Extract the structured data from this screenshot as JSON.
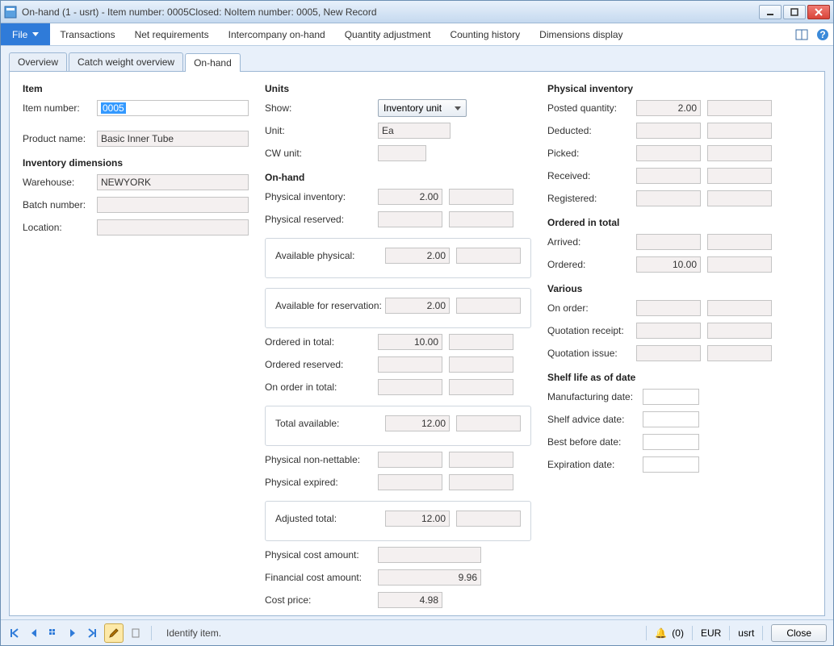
{
  "window": {
    "title": "On-hand (1 - usrt) - Item number: 0005Closed: NoItem number: 0005, New Record"
  },
  "menu": {
    "file": "File",
    "items": [
      "Transactions",
      "Net requirements",
      "Intercompany on-hand",
      "Quantity adjustment",
      "Counting history",
      "Dimensions display"
    ]
  },
  "tabs": {
    "overview": "Overview",
    "cw": "Catch weight overview",
    "onhand": "On-hand"
  },
  "item": {
    "header": "Item",
    "item_number_label": "Item number:",
    "item_number": "0005",
    "product_name_label": "Product name:",
    "product_name": "Basic Inner Tube",
    "inv_dim_header": "Inventory dimensions",
    "warehouse_label": "Warehouse:",
    "warehouse": "NEWYORK",
    "batch_label": "Batch number:",
    "batch": "",
    "location_label": "Location:",
    "location": ""
  },
  "units": {
    "header": "Units",
    "show_label": "Show:",
    "show_value": "Inventory unit",
    "unit_label": "Unit:",
    "unit": "Ea",
    "cw_label": "CW unit:",
    "cw": ""
  },
  "onhand": {
    "header": "On-hand",
    "phys_inv_label": "Physical inventory:",
    "phys_inv": "2.00",
    "phys_res_label": "Physical reserved:",
    "phys_res": "",
    "avail_phys_label": "Available physical:",
    "avail_phys": "2.00",
    "avail_res_label": "Available for reservation:",
    "avail_res": "2.00",
    "ord_total_label": "Ordered in total:",
    "ord_total": "10.00",
    "ord_res_label": "Ordered reserved:",
    "ord_res": "",
    "on_order_label": "On order in total:",
    "on_order": "",
    "total_avail_label": "Total available:",
    "total_avail": "12.00",
    "non_net_label": "Physical non-nettable:",
    "non_net": "",
    "expired_label": "Physical expired:",
    "expired": "",
    "adj_total_label": "Adjusted total:",
    "adj_total": "12.00",
    "phys_cost_label": "Physical cost amount:",
    "phys_cost": "",
    "fin_cost_label": "Financial cost amount:",
    "fin_cost": "9.96",
    "cost_price_label": "Cost price:",
    "cost_price": "4.98"
  },
  "physinv": {
    "header": "Physical inventory",
    "posted_label": "Posted quantity:",
    "posted": "2.00",
    "deducted_label": "Deducted:",
    "deducted": "",
    "picked_label": "Picked:",
    "picked": "",
    "received_label": "Received:",
    "received": "",
    "registered_label": "Registered:",
    "registered": ""
  },
  "ordtot": {
    "header": "Ordered in total",
    "arrived_label": "Arrived:",
    "arrived": "",
    "ordered_label": "Ordered:",
    "ordered": "10.00"
  },
  "various": {
    "header": "Various",
    "on_order_label": "On order:",
    "on_order": "",
    "qrec_label": "Quotation receipt:",
    "qrec": "",
    "qiss_label": "Quotation issue:",
    "qiss": ""
  },
  "shelf": {
    "header": "Shelf life as of date",
    "mfg_label": "Manufacturing date:",
    "adv_label": "Shelf advice date:",
    "best_label": "Best before date:",
    "exp_label": "Expiration date:"
  },
  "status": {
    "hint": "Identify item.",
    "bell": "(0)",
    "currency": "EUR",
    "user": "usrt",
    "close": "Close"
  }
}
